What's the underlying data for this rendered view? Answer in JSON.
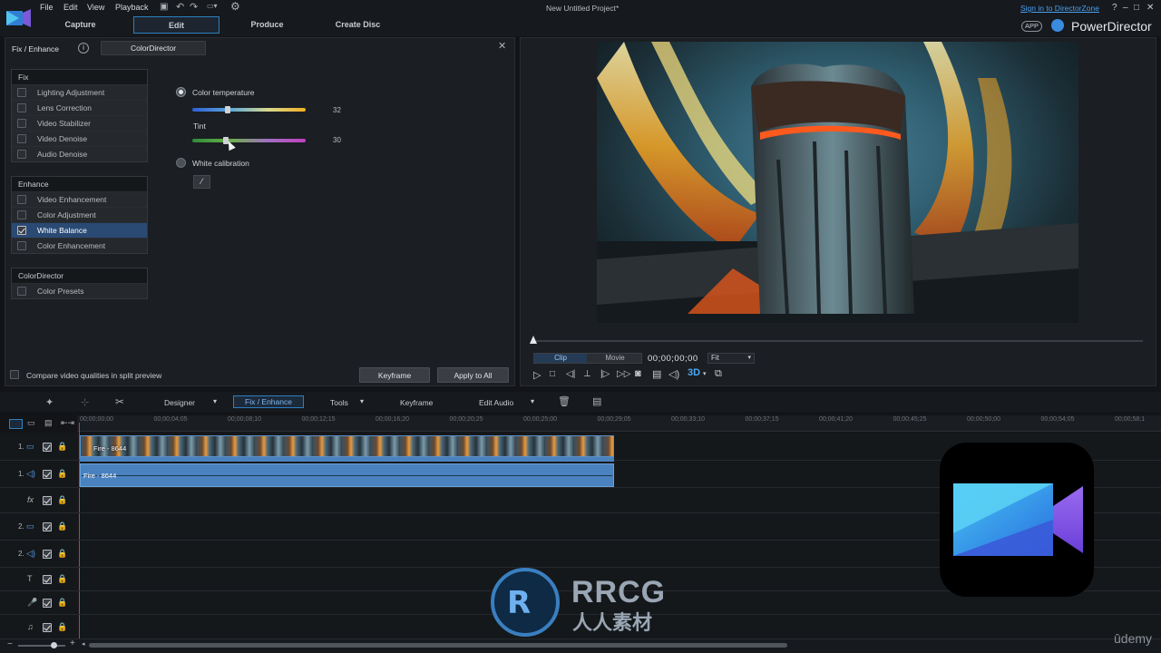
{
  "app": {
    "menu": [
      "File",
      "Edit",
      "View",
      "Playback"
    ],
    "project_title": "New Untitled Project*",
    "sign_in": "Sign in to DirectorZone",
    "app_badge": "APP",
    "brand": "PowerDirector",
    "tabs": [
      "Capture",
      "Edit",
      "Produce",
      "Create Disc"
    ],
    "window_controls": [
      "?",
      "–",
      "□",
      "✕"
    ]
  },
  "fix_panel": {
    "title": "Fix / Enhance",
    "info": "i",
    "colordirector_tab": "ColorDirector",
    "close": "✕",
    "fix_header": "Fix",
    "fix_items": [
      "Lighting Adjustment",
      "Lens Correction",
      "Video Stabilizer",
      "Video Denoise",
      "Audio Denoise"
    ],
    "enhance_header": "Enhance",
    "enhance_items": [
      "Video Enhancement",
      "Color Adjustment",
      "White Balance",
      "Color Enhancement"
    ],
    "cd_header": "ColorDirector",
    "cd_items": [
      "Color Presets"
    ],
    "color_temp_label": "Color temperature",
    "color_temp_value": "32",
    "tint_label": "Tint",
    "tint_value": "30",
    "white_calibration_label": "White calibration",
    "compare_label": "Compare video qualities in split preview",
    "keyframe_button": "Keyframe",
    "apply_all_button": "Apply to All"
  },
  "preview": {
    "clip_tab": "Clip",
    "movie_tab": "Movie",
    "timecode": "00;00;00;00",
    "fit": "Fit"
  },
  "timeline_toolbar": {
    "designer": "Designer",
    "fix_enhance": "Fix / Enhance",
    "tools": "Tools",
    "keyframe": "Keyframe",
    "edit_audio": "Edit Audio"
  },
  "ruler": [
    "00;00;00;00",
    "00;00;04;05",
    "00;00;08;10",
    "00;00;12;15",
    "00;00;16;20",
    "00;00;20;25",
    "00;00;25;00",
    "00;00;29;05",
    "00;00;33;10",
    "00;00;37;15",
    "00;00;41;20",
    "00;00;45;25",
    "00;00;50;00",
    "00;00;54;05",
    "00;00;58;1"
  ],
  "tracks": [
    "1.",
    "1.",
    "fx",
    "2.",
    "2.",
    "T",
    "",
    ""
  ],
  "clips": {
    "video_label": "Fire - 8644",
    "audio_label": "Fire - 8644"
  },
  "watermark": {
    "main": "RRCG",
    "sub": "人人素材",
    "udemy": "ûdemy"
  },
  "colors": {
    "accent": "#2d7fc1",
    "selected_row": "#2a4a74",
    "clip_blue": "#4a82c0"
  }
}
